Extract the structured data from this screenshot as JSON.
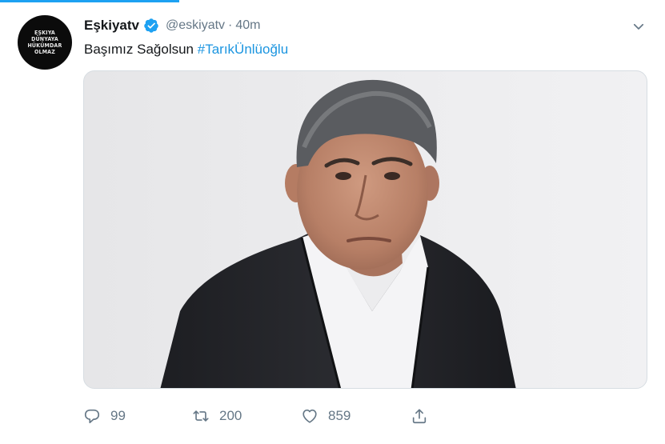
{
  "progress": {
    "fraction": 0.27
  },
  "avatar": {
    "lines": [
      "EŞKIYA",
      "DÜNYAYA",
      "HÜKÜMDAR",
      "OLMAZ"
    ]
  },
  "tweet": {
    "display_name": "Eşkiyatv",
    "handle": "@eskiyatv",
    "separator": "·",
    "time": "40m",
    "text": "Başımız Sağolsun",
    "hashtag": "#TarıkÜnlüoğlu"
  },
  "actions": {
    "reply_count": "99",
    "retweet_count": "200",
    "like_count": "859"
  },
  "icons": {
    "verified": "verified-badge-icon",
    "caret": "chevron-down-icon",
    "reply": "reply-icon",
    "retweet": "retweet-icon",
    "like": "heart-icon",
    "share": "share-icon"
  },
  "colors": {
    "accent": "#1da1f2",
    "hashtag": "#1b95e0",
    "secondary_text": "#657786"
  }
}
